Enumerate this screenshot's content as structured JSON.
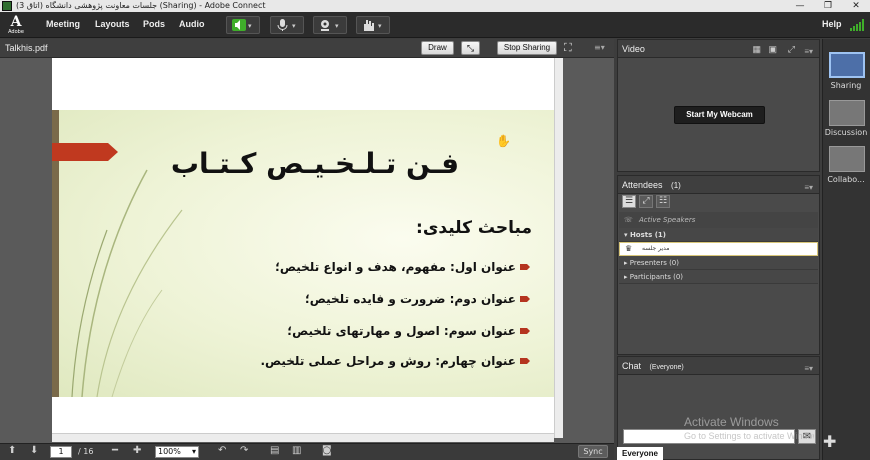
{
  "window": {
    "title": "جلسات معاونت پژوهشی دانشگاه (اتاق 3) (Sharing) - Adobe Connect",
    "controls": [
      "—",
      "❐",
      "✕"
    ]
  },
  "menubar": {
    "logo_text": "Adobe",
    "items": [
      "Meeting",
      "Layouts",
      "Pods",
      "Audio"
    ],
    "help": "Help"
  },
  "share_pod": {
    "file_name": "Talkhis.pdf",
    "draw_label": "Draw",
    "stop_sharing_label": "Stop Sharing",
    "footer": {
      "page_value": "1",
      "page_total": "/ 16",
      "zoom": "100%",
      "sync_label": "Sync"
    }
  },
  "slide": {
    "title": "فـن تـلـخـیـص کـتـاب",
    "subtitle": "مباحث کلیدی:",
    "bullets": [
      "عنوان اول: مفهوم، هدف و انواع تلخیص؛",
      "عنوان دوم: ضرورت و فایده تلخیص؛",
      "عنوان سوم: اصول و مهارتهای تلخیص؛",
      "عنوان چهارم: روش و مراحل عملی تلخیص."
    ],
    "accent_color": "#b5341f"
  },
  "video_pod": {
    "title": "Video",
    "start_webcam_label": "Start My Webcam"
  },
  "attendees_pod": {
    "title": "Attendees",
    "count": "(1)",
    "active_speakers": "Active Speakers",
    "hosts": "Hosts (1)",
    "host_name": "مدیر جلسه",
    "presenters": "Presenters (0)",
    "participants": "Participants (0)"
  },
  "chat_pod": {
    "title": "Chat",
    "scope": "(Everyone)",
    "tab_label": "Everyone"
  },
  "watermark": {
    "line1": "Activate Windows",
    "line2": "Go to Settings to activate Windows."
  },
  "layouts": [
    {
      "label": "Sharing"
    },
    {
      "label": "Discussion"
    },
    {
      "label": "Collabo..."
    }
  ]
}
